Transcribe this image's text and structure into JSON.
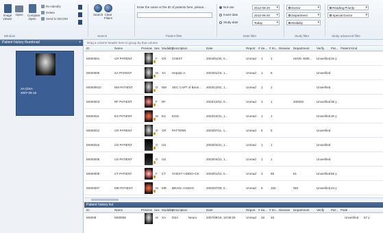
{
  "ribbon": {
    "buttons": [
      {
        "label": "Image viewer"
      },
      {
        "label": "Open"
      },
      {
        "label": "Compare Open"
      }
    ],
    "small_items": [
      "Re-Identify",
      "Delete",
      "Send to DICOM"
    ],
    "search_btn": "Search",
    "clear_btn": "Clear Filters",
    "groups": {
      "window": "Window",
      "search": "Search",
      "patient_filter": "Patient filter",
      "date_filter": "Date filter",
      "study_filter": "Study filter",
      "study_adv": "Study advanced filter"
    },
    "patient_search_placeholder": "Enter the name or the ID of patients here, please...",
    "date_radios": [
      {
        "label": "Not use",
        "from": "2012-06-20"
      },
      {
        "label": "Insert date",
        "from": "2012-06-20"
      },
      {
        "label": "Study date",
        "from": "Today"
      }
    ],
    "study_filter": [
      "Doctor",
      "Department",
      "Modality"
    ],
    "study_adv": [
      "Reading Priority",
      "Special Doctor"
    ]
  },
  "left": {
    "title": "Patient history thumbnail",
    "close": "×",
    "thumb_line1": "XA (DSA",
    "thumb_line2": "2007-09-18"
  },
  "grid": {
    "grouping_hint": "Drag a column header here to group by that column",
    "columns": [
      "ID",
      "Name",
      "Preview",
      "Sex",
      "Modality",
      "Description",
      "Date",
      "Report",
      "# Se...",
      "# Im...",
      "Disease",
      "Department",
      "Verify",
      "Pat...",
      "Patient Kind"
    ],
    "rows": [
      {
        "id": "MS00001",
        "name": "CR PATIENT",
        "sex": "F",
        "mod": "CR",
        "desc": "CHEST",
        "date": "2004/01/30, 0...",
        "report": "Unread",
        "se": "1",
        "im": "1",
        "disease": "",
        "dept": "ISINO 4008...",
        "verify": "Unverified",
        "pat": "26 y",
        "pv": "cr"
      },
      {
        "id": "MS00005",
        "name": "XA PATIENT",
        "sex": "M",
        "mod": "XA",
        "desc": "Hepatic A.",
        "date": "2004/01/15, 1...",
        "report": "Unread",
        "se": "1",
        "im": "8",
        "disease": "",
        "dept": "",
        "verify": "Unverified",
        "pat": "",
        "pv": "xa"
      },
      {
        "id": "MS000010",
        "name": "NM PATIENT",
        "sex": "O",
        "mod": "NM",
        "desc": "SEC CAPT of Bone...",
        "date": "2003/12/02, 1...",
        "report": "Unread",
        "se": "1",
        "im": "1",
        "disease": "",
        "dept": "",
        "verify": "Unverified",
        "pat": "",
        "pv": "nm"
      },
      {
        "id": "MS00003",
        "name": "RF PATIENT",
        "sex": "F",
        "mod": "RF",
        "desc": "",
        "date": "2003/12/02, 0...",
        "report": "Unread",
        "se": "1",
        "im": "1",
        "disease": "",
        "dept": "400025",
        "verify": "Unverified",
        "pat": "38 y",
        "pv": "rf"
      },
      {
        "id": "MS00011",
        "name": "ES PATIENT",
        "sex": "M",
        "mod": "ES",
        "desc": "EGD",
        "date": "2003/10/31, 1...",
        "report": "Unread",
        "se": "1",
        "im": "1",
        "disease": "",
        "dept": "",
        "verify": "Unverified",
        "pat": "30 y",
        "pv": "mr"
      },
      {
        "id": "MS00012",
        "name": "CR PATIENT",
        "sex": "O",
        "mod": "CR",
        "desc": "PATTERN",
        "date": "2003/07/11, 1...",
        "report": "Unread",
        "se": "5",
        "im": "5",
        "disease": "",
        "dept": "",
        "verify": "Unverified",
        "pat": "",
        "pv": "cr"
      },
      {
        "id": "MS00015",
        "name": "US PATIENT",
        "sex": "O",
        "mod": "US",
        "desc": "",
        "date": "2003/04/21, 1...",
        "report": "Unread",
        "se": "1",
        "im": "1",
        "disease": "",
        "dept": "",
        "verify": "Unverified",
        "pat": "",
        "pv": "us"
      },
      {
        "id": "MS00006",
        "name": "US PATIENT",
        "sex": "O",
        "mod": "US",
        "desc": "",
        "date": "2003/04/21, 1...",
        "report": "Unread",
        "se": "1",
        "im": "1",
        "disease": "",
        "dept": "",
        "verify": "Unverified",
        "pat": "",
        "pv": "us"
      },
      {
        "id": "MS00008",
        "name": "CT PATIENT",
        "sex": "F",
        "mod": "CT",
        "desc": "CHEST+ABDO+CE",
        "date": "2003/01/10, 0...",
        "report": "Unread",
        "se": "4",
        "im": "85",
        "disease": "",
        "dept": "61",
        "verify": "Unverified",
        "pat": "55 y",
        "pv": "ct"
      },
      {
        "id": "MS00007",
        "name": "MR PATIENT",
        "sex": "M",
        "mod": "MR",
        "desc": "BRAIN +ANGIO",
        "date": "2002/07/09, 0...",
        "report": "Unread",
        "se": "9",
        "im": "150",
        "disease": "",
        "dept": "NM",
        "verify": "Unverified",
        "pat": "43 y",
        "pv": "mr"
      }
    ]
  },
  "bottom": {
    "title": "Patient history list",
    "columns": [
      "ID",
      "Name",
      "Preview",
      "Sex",
      "Modality",
      "Description",
      "Date",
      "Report",
      "# Se...",
      "# Im...",
      "Disease",
      "Department",
      "Verify",
      "Pat...",
      "Patie"
    ],
    "row": {
      "id": "MS008",
      "name": "MS0008",
      "sex": "M",
      "mod": "XA",
      "desc": "DSA",
      "desc2": "Neuro",
      "date": "2007/09/18, 10:05:29",
      "report": "Unread",
      "se": "16",
      "im": "48",
      "verify": "Unverified",
      "pat": "67 y"
    }
  }
}
